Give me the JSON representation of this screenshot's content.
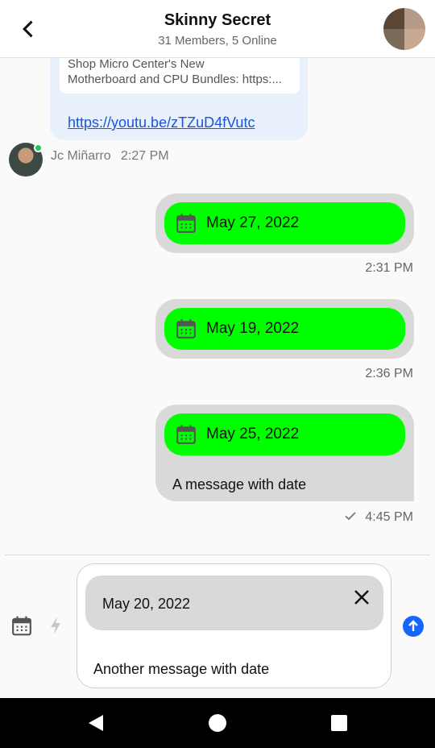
{
  "header": {
    "title": "Skinny Secret",
    "subtitle": "31 Members, 5 Online"
  },
  "link_message": {
    "preview_lines": [
      "Shop Micro Center's New",
      "Motherboard and CPU Bundles: https:..."
    ],
    "url": "https://youtu.be/zTZuD4fVutc"
  },
  "sender": {
    "name": "Jc Miñarro",
    "time": "2:27 PM"
  },
  "messages": [
    {
      "date": "May 27, 2022",
      "time": "2:31 PM"
    },
    {
      "date": "May 19, 2022",
      "time": "2:36 PM"
    },
    {
      "date": "May 25, 2022",
      "text": "A message with date",
      "time": "4:45 PM"
    }
  ],
  "composer": {
    "attached_date": "May 20, 2022",
    "text": "Another message with date"
  },
  "colors": {
    "date_chip": "#00ff00",
    "bubble": "#d9d9d9",
    "link": "#1a56d6",
    "send": "#1565ff",
    "online": "#22c55e"
  },
  "icons": [
    "back-icon",
    "calendar-icon",
    "bolt-icon",
    "close-icon",
    "send-icon",
    "check-icon"
  ]
}
